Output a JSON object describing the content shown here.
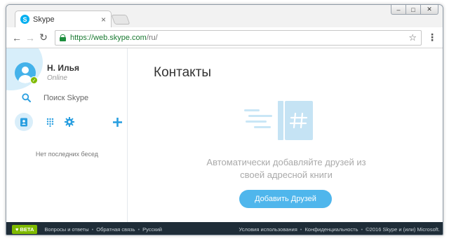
{
  "browser": {
    "tab_title": "Skype",
    "tab_favicon_letter": "S",
    "tab_close": "×",
    "url_host": "https://web.skype.com",
    "url_path": "/ru/",
    "window_controls": {
      "minimize": "–",
      "maximize": "□",
      "close": "✕"
    }
  },
  "profile": {
    "name": "Н. Илья",
    "status": "Online"
  },
  "sidebar": {
    "search_placeholder": "Поиск Skype",
    "no_conversations": "Нет последних бесед"
  },
  "main": {
    "title": "Контакты",
    "promo_line1": "Автоматически добавляйте друзей из",
    "promo_line2": "своей адресной книги",
    "add_friends_label": "Добавить Друзей"
  },
  "footer": {
    "beta_label": "BETA",
    "faq": "Вопросы и ответы",
    "feedback": "Обратная связь",
    "language": "Русский",
    "terms": "Условия использования",
    "privacy": "Конфиденциальность",
    "copyright": "©2016 Skype и (или) Microsoft."
  },
  "colors": {
    "skype_blue": "#00aff0",
    "button_blue": "#4fb6ec",
    "online_green": "#7fba00",
    "footer_bg": "#1f2d38"
  }
}
